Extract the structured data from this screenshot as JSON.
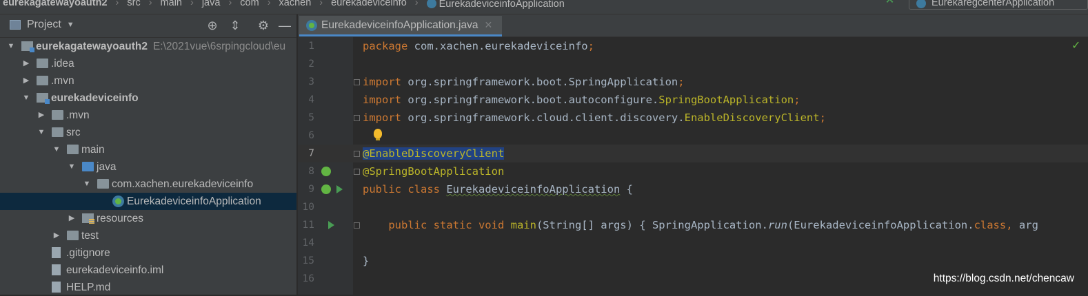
{
  "breadcrumbs": [
    "eurekagatewayoauth2",
    "src",
    "main",
    "java",
    "com",
    "xachen",
    "eurekadeviceinfo",
    "EurekadeviceinfoApplication"
  ],
  "run_config": "EurekaregcenterApplication",
  "project_panel": {
    "title": "Project",
    "icons": [
      "crosshair-icon",
      "collapse-all-icon",
      "gear-icon",
      "minimize-icon"
    ],
    "tree": [
      {
        "label": "eurekagatewayoauth2",
        "path": "E:\\2021vue\\6srpingcloud\\eu",
        "bold": true,
        "expanded": true
      },
      {
        "label": ".idea"
      },
      {
        "label": ".mvn"
      },
      {
        "label": "eurekadeviceinfo",
        "bold": true,
        "expanded": true
      },
      {
        "label": ".mvn"
      },
      {
        "label": "src",
        "expanded": true
      },
      {
        "label": "main",
        "expanded": true
      },
      {
        "label": "java",
        "expanded": true
      },
      {
        "label": "com.xachen.eurekadeviceinfo",
        "expanded": true
      },
      {
        "label": "EurekadeviceinfoApplication",
        "selected": true
      },
      {
        "label": "resources"
      },
      {
        "label": "test"
      },
      {
        "label": ".gitignore"
      },
      {
        "label": "eurekadeviceinfo.iml"
      },
      {
        "label": "HELP.md"
      }
    ]
  },
  "editor": {
    "tab_label": "EurekadeviceinfoApplication.java",
    "lines": [
      {
        "n": "1",
        "parts": [
          [
            "kw",
            "package "
          ],
          [
            "plain",
            "com.xachen.eurekadeviceinfo"
          ],
          [
            "kw",
            ";"
          ]
        ]
      },
      {
        "n": "2",
        "parts": []
      },
      {
        "n": "3",
        "parts": [
          [
            "kw",
            "import "
          ],
          [
            "plain",
            "org.springframework.boot.SpringApplication"
          ],
          [
            "kw",
            ";"
          ]
        ]
      },
      {
        "n": "4",
        "parts": [
          [
            "kw",
            "import "
          ],
          [
            "plain",
            "org.springframework.boot.autoconfigure."
          ],
          [
            "ann",
            "SpringBootApplication"
          ],
          [
            "kw",
            ";"
          ]
        ]
      },
      {
        "n": "5",
        "parts": [
          [
            "kw",
            "import "
          ],
          [
            "plain",
            "org.springframework.cloud.client.discovery."
          ],
          [
            "ann",
            "EnableDiscoveryClient"
          ],
          [
            "kw",
            ";"
          ]
        ]
      },
      {
        "n": "6",
        "parts": []
      },
      {
        "n": "7",
        "parts": [
          [
            "ann hl",
            "@EnableDiscoveryClient"
          ]
        ]
      },
      {
        "n": "8",
        "parts": [
          [
            "ann",
            "@SpringBootApplication"
          ]
        ]
      },
      {
        "n": "9",
        "parts": [
          [
            "kw",
            "public class "
          ],
          [
            "plain und",
            "EurekadeviceinfoApplication"
          ],
          [
            "plain",
            " {"
          ]
        ]
      },
      {
        "n": "10",
        "parts": []
      },
      {
        "n": "11",
        "parts": [
          [
            "plain",
            "    "
          ],
          [
            "kw",
            "public static void "
          ],
          [
            "ann",
            "main"
          ],
          [
            "plain",
            "(String[] args) "
          ],
          [
            "plain",
            "{ "
          ],
          [
            "plain",
            "SpringApplication."
          ],
          [
            "plain italic",
            "run"
          ],
          [
            "plain",
            "(EurekadeviceinfoApplication."
          ],
          [
            "kw",
            "class"
          ],
          [
            "kw",
            ", "
          ],
          [
            "plain",
            "arg"
          ]
        ]
      },
      {
        "n": "14",
        "parts": []
      },
      {
        "n": "15",
        "parts": [
          [
            "plain",
            "}"
          ]
        ]
      },
      {
        "n": "16",
        "parts": []
      }
    ]
  },
  "watermark": "https://blog.csdn.net/chencaw",
  "colors": {
    "keyword": "#cc7832",
    "annotation": "#bbb529",
    "text": "#a9b7c6",
    "selection": "#214283",
    "accent": "#4a88c7"
  }
}
